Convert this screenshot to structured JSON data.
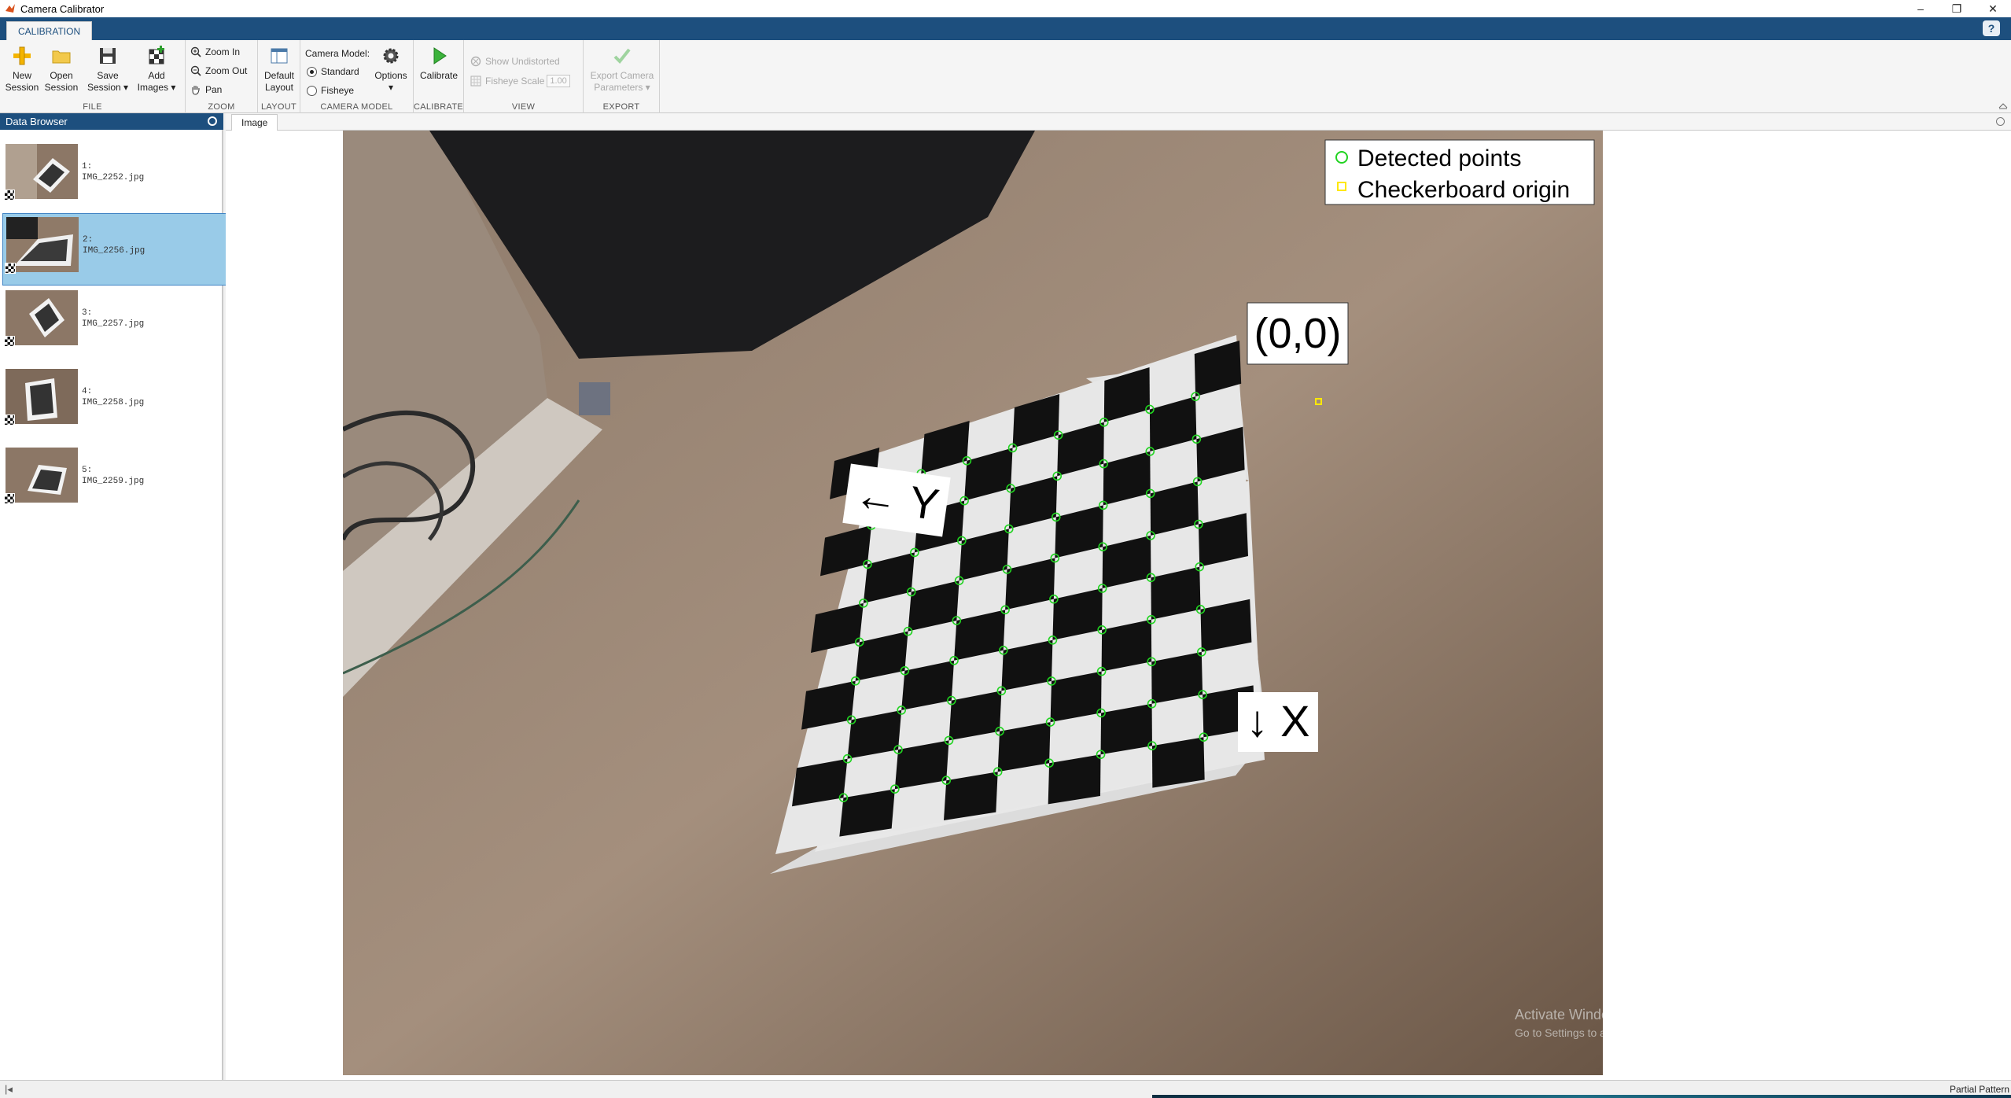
{
  "window": {
    "title": "Camera Calibrator",
    "controls": [
      "–",
      "❐",
      "✕"
    ]
  },
  "ribbon": {
    "tab_label": "CALIBRATION",
    "help_label": "?"
  },
  "toolstrip": {
    "file": {
      "section_label": "FILE",
      "new_session": "New\nSession",
      "open_session": "Open\nSession",
      "save_session": "Save\nSession ▾",
      "add_images": "Add\nImages ▾"
    },
    "zoom": {
      "section_label": "ZOOM",
      "zoom_in": "Zoom In",
      "zoom_out": "Zoom Out",
      "pan": "Pan"
    },
    "layout": {
      "section_label": "LAYOUT",
      "default_layout": "Default\nLayout"
    },
    "camera_model": {
      "section_label": "CAMERA MODEL",
      "heading": "Camera Model:",
      "standard": "Standard",
      "fisheye": "Fisheye",
      "selected": "Standard",
      "options": "Options\n▾"
    },
    "calibrate": {
      "section_label": "CALIBRATE",
      "calibrate": "Calibrate"
    },
    "view": {
      "section_label": "VIEW",
      "show_undistorted": "Show Undistorted",
      "fisheye_scale": "Fisheye Scale",
      "fisheye_scale_value": "1.00"
    },
    "export": {
      "section_label": "EXPORT",
      "export_params": "Export Camera\nParameters ▾"
    }
  },
  "data_browser": {
    "title": "Data Browser",
    "items": [
      {
        "index": "1:",
        "filename": "IMG_2252.jpg",
        "selected": false
      },
      {
        "index": "2:",
        "filename": "IMG_2256.jpg",
        "selected": true
      },
      {
        "index": "3:",
        "filename": "IMG_2257.jpg",
        "selected": false
      },
      {
        "index": "4:",
        "filename": "IMG_2258.jpg",
        "selected": false
      },
      {
        "index": "5:",
        "filename": "IMG_2259.jpg",
        "selected": false
      }
    ]
  },
  "image_panel": {
    "tab_label": "Image",
    "legend": {
      "detected": "Detected points",
      "origin": "Checkerboard origin"
    },
    "labels": {
      "origin": "(0,0)",
      "y_axis": "← Y",
      "x_axis": "↓ X"
    },
    "watermark": {
      "line1": "Activate Windows",
      "line2": "Go to Settings to activate Windows."
    }
  },
  "statusbar": {
    "left_icon": "|◂",
    "right_text": "Partial Pattern"
  },
  "colors": {
    "accent": "#1d4f7e",
    "selection": "#99cbe8",
    "detected": "#21d321",
    "origin": "#ffe800"
  }
}
